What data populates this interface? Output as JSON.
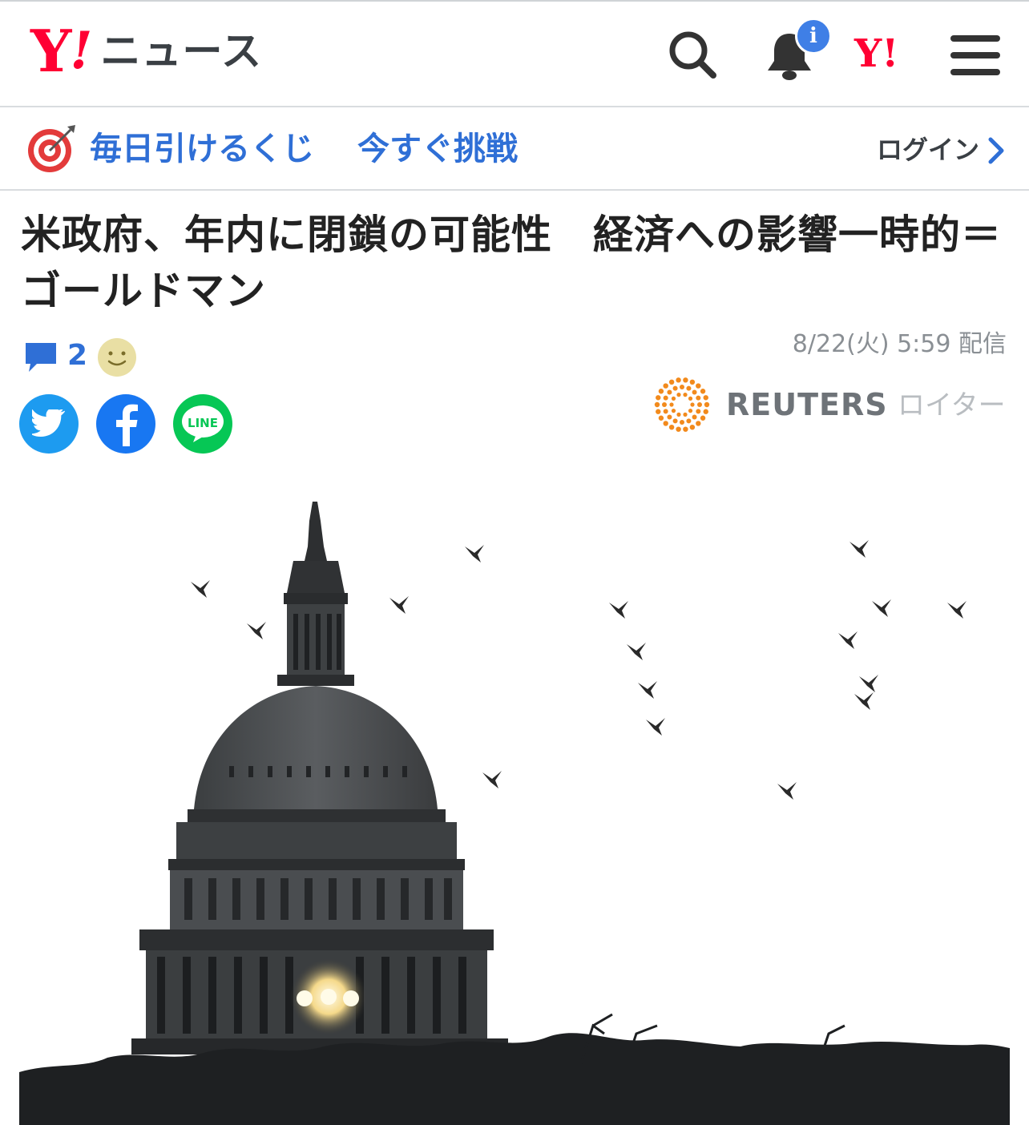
{
  "header": {
    "logo_mark": "Y",
    "logo_bang": "!",
    "logo_text": "ニュース",
    "notice_badge": "i",
    "yahoo_link": "Y!"
  },
  "promo": {
    "label": "毎日引けるくじ",
    "cta": "今すぐ挑戦",
    "login": "ログイン"
  },
  "article": {
    "title": "米政府、年内に閉鎖の可能性　経済への影響一時的＝ゴールドマン",
    "comment_count": "2",
    "date": "8/22(火) 5:59 配信",
    "source_name": "REUTERS",
    "source_kana": "ロイター",
    "share_line_label": "LINE"
  },
  "icons": [
    "search-icon",
    "bell-icon",
    "menu-icon",
    "target-icon",
    "chevron-right-icon",
    "comment-icon",
    "smile-icon",
    "twitter-icon",
    "facebook-icon",
    "line-icon",
    "reuters-logo"
  ],
  "colors": {
    "brand_red": "#ff0033",
    "link_blue": "#2f6fd6",
    "twitter": "#1d9bf0",
    "facebook": "#1877f2",
    "line": "#06c755",
    "reuters_orange": "#f28a1c"
  }
}
